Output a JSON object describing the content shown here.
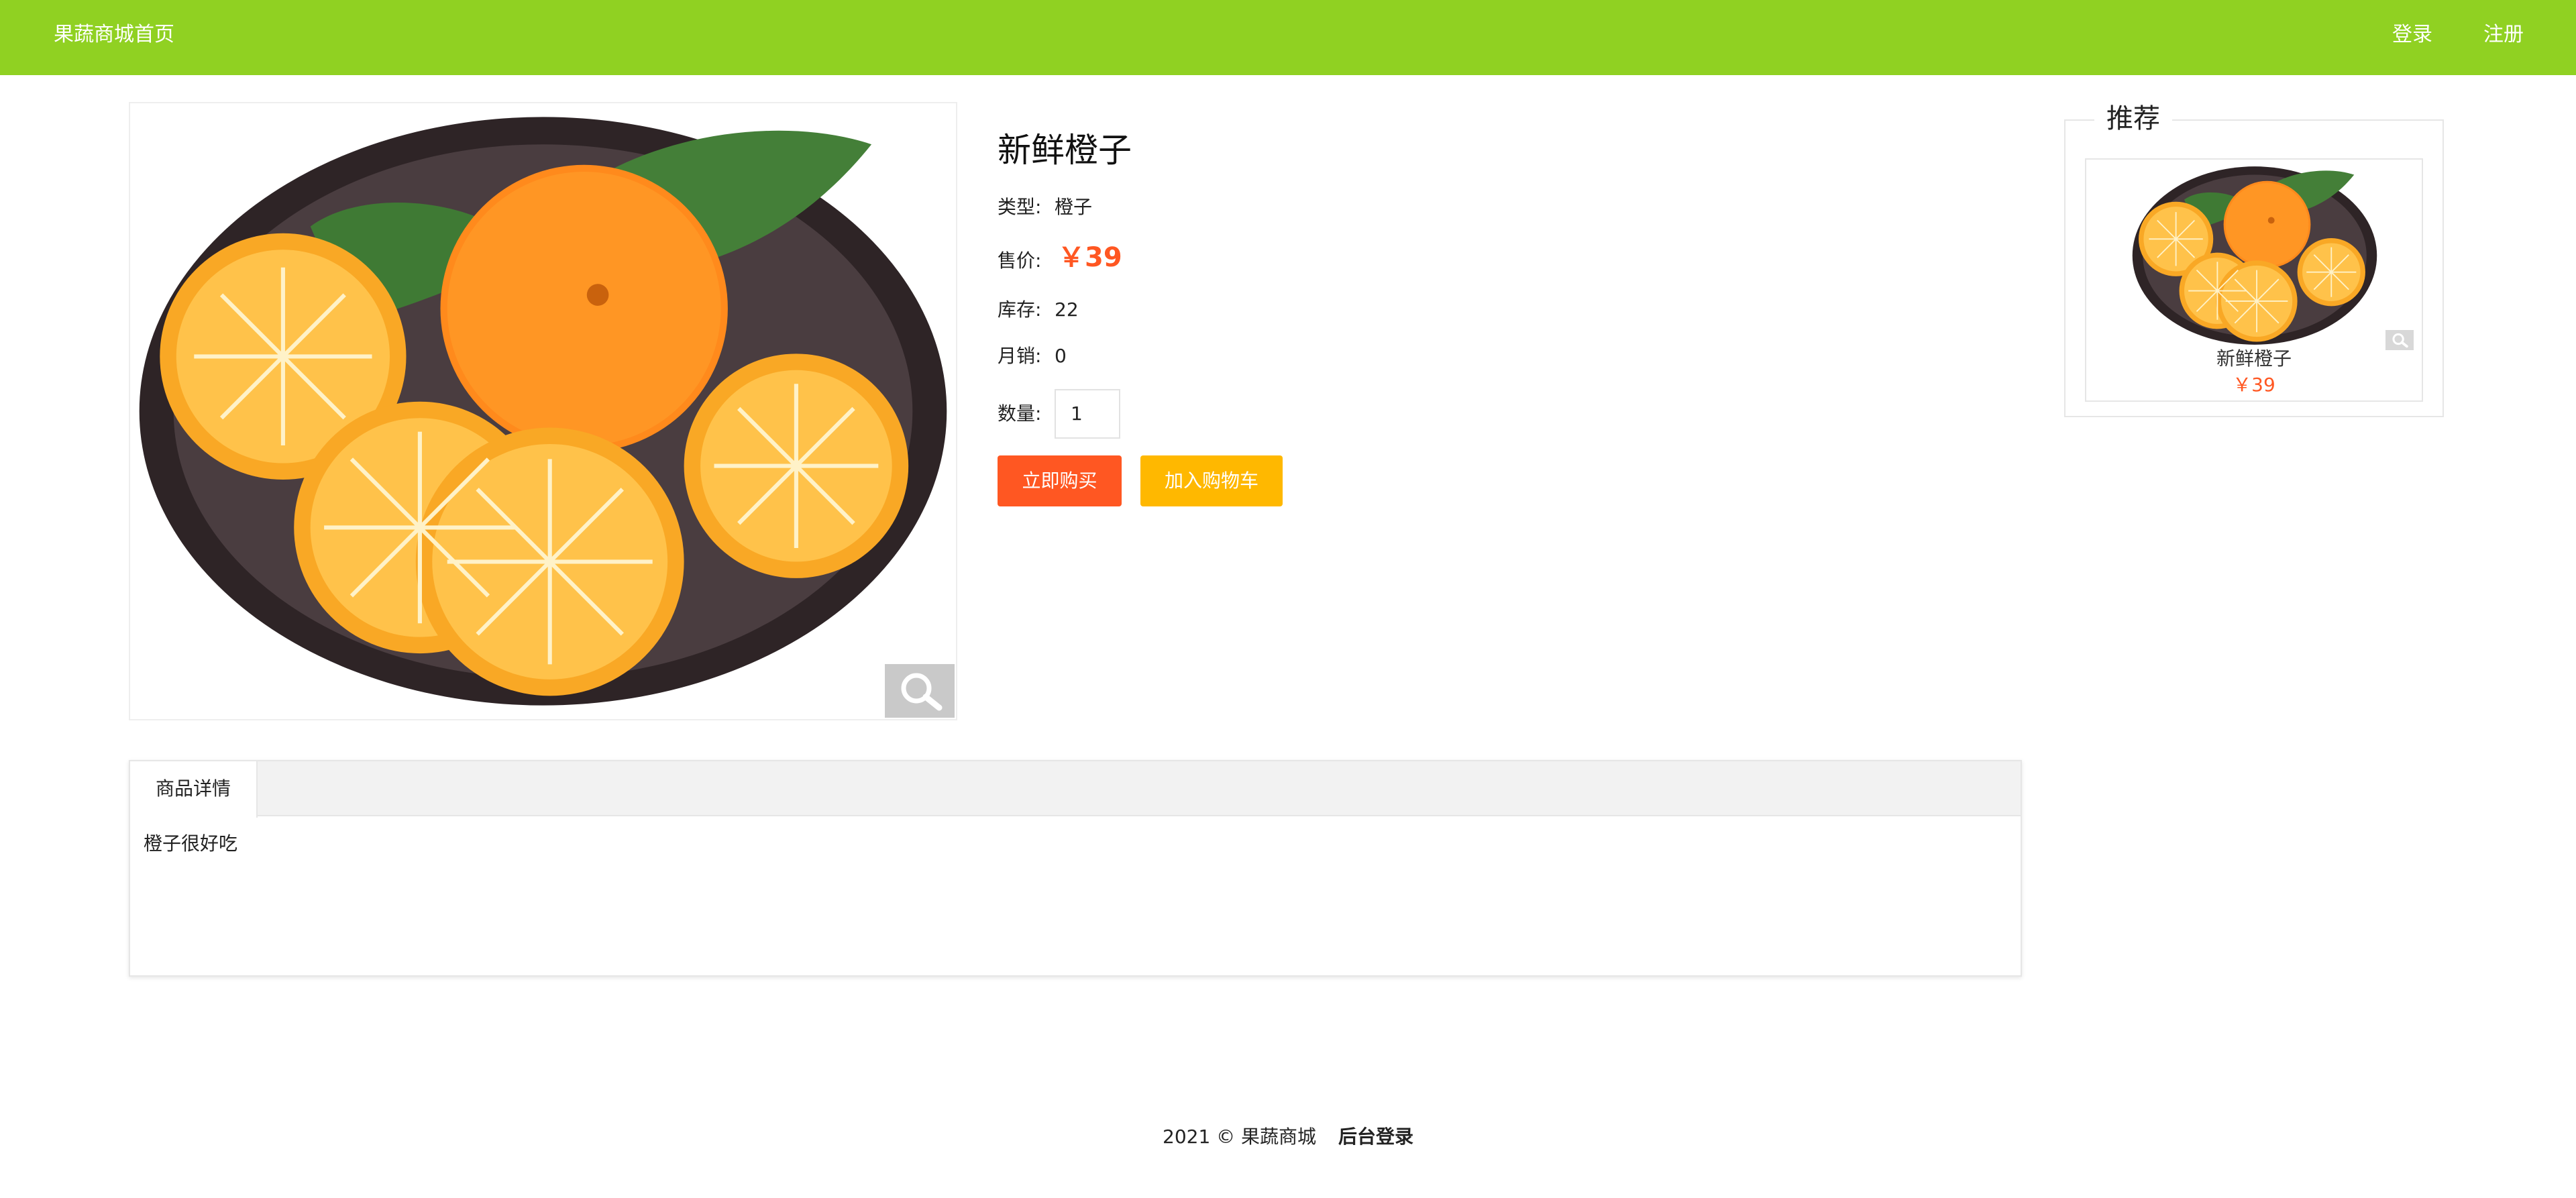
{
  "header": {
    "home_label": "果蔬商城首页",
    "login_label": "登录",
    "register_label": "注册",
    "color": "#90d122"
  },
  "product": {
    "title": "新鲜橙子",
    "type_label": "类型:",
    "type_value": "橙子",
    "price_label": "售价:",
    "price_value": "￥39",
    "stock_label": "库存:",
    "stock_value": "22",
    "monthly_sales_label": "月销:",
    "monthly_sales_value": "0",
    "quantity_label": "数量:",
    "quantity_value": "1",
    "buy_now_label": "立即购买",
    "add_to_cart_label": "加入购物车",
    "image_icon": "orange-photo",
    "zoom_icon": "magnifier-icon"
  },
  "tabs": {
    "items": [
      {
        "label": "商品详情"
      }
    ],
    "active": 0,
    "content": "橙子很好吃"
  },
  "recommend": {
    "title": "推荐",
    "items": [
      {
        "name": "新鲜橙子",
        "price": "￥39"
      }
    ]
  },
  "footer": {
    "copyright": "2021 © 果蔬商城",
    "admin_login_label": "后台登录"
  },
  "colors": {
    "accent": "#ff5722",
    "cart_button": "#ffb800",
    "header": "#90d122"
  }
}
